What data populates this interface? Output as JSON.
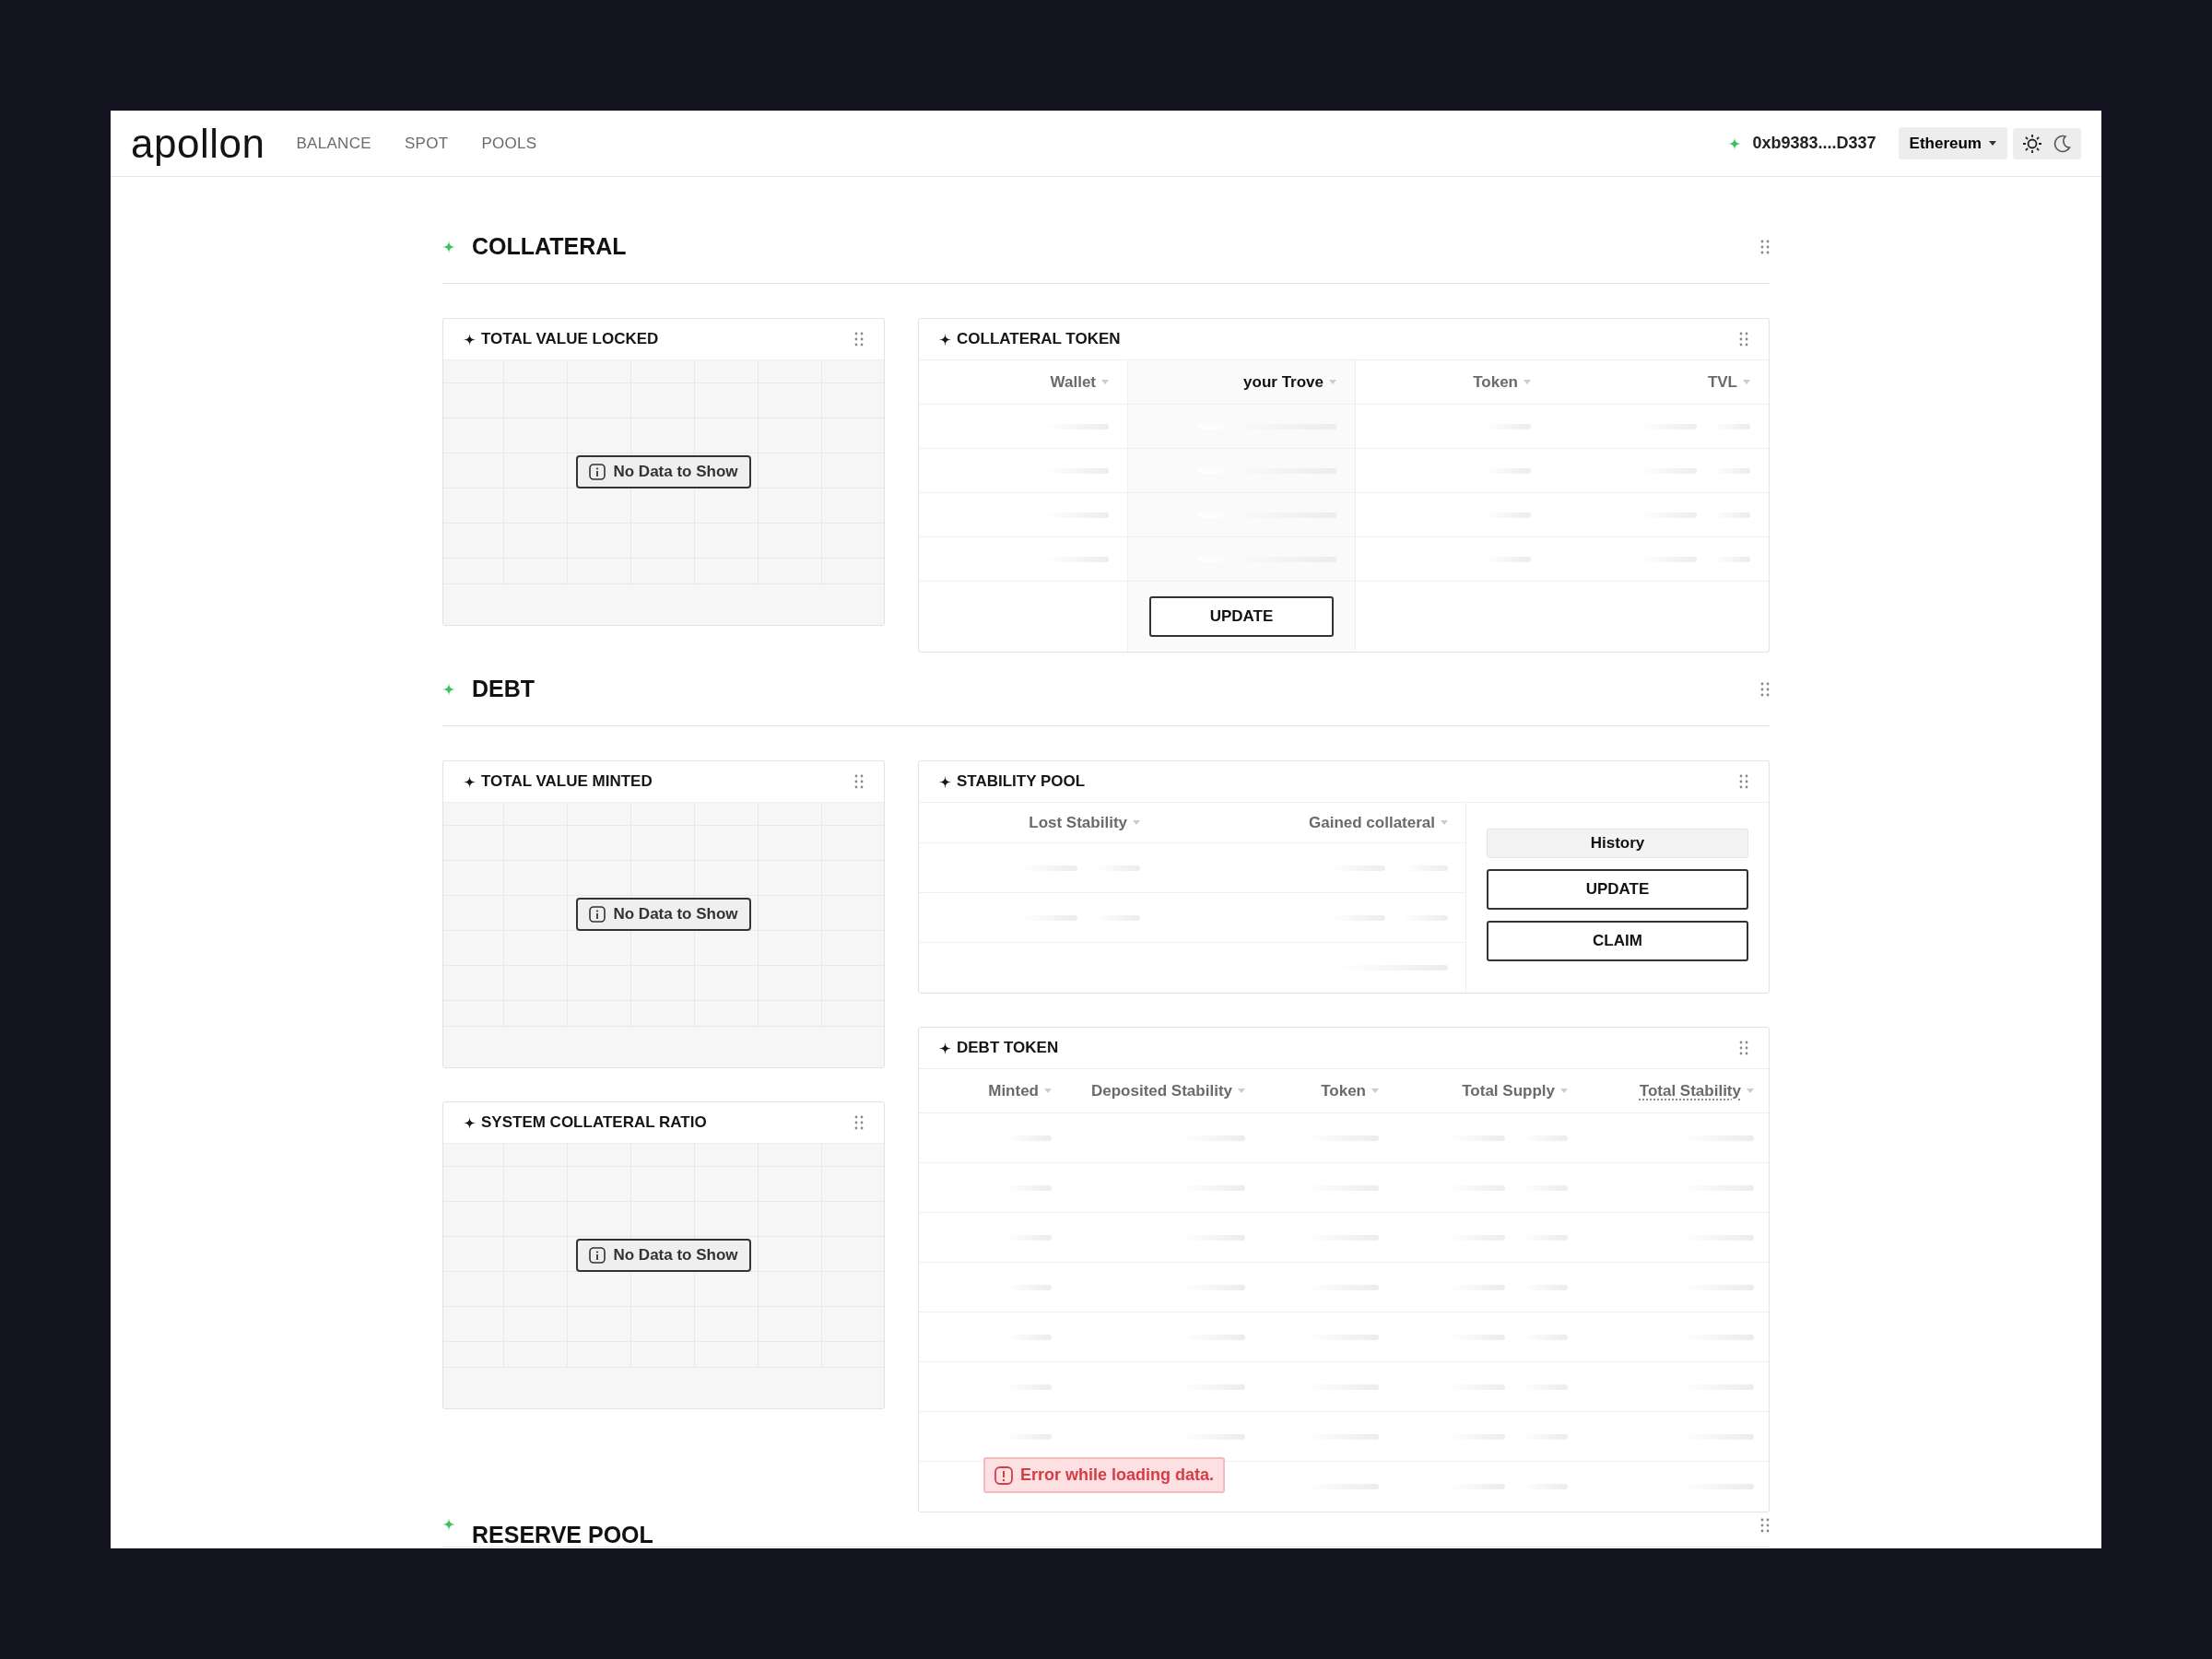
{
  "header": {
    "logo": "apollon",
    "nav": [
      {
        "label": "BALANCE"
      },
      {
        "label": "SPOT"
      },
      {
        "label": "POOLS"
      }
    ],
    "wallet_address": "0xb9383....D337",
    "network": "Ethereum"
  },
  "sections": [
    {
      "title": "COLLATERAL",
      "left": [
        {
          "kind": "chart",
          "title": "TOTAL VALUE LOCKED",
          "empty_message": "No Data to Show"
        }
      ],
      "right": [
        {
          "kind": "token_table",
          "title": "COLLATERAL TOKEN",
          "loading": true,
          "columns": [
            {
              "label": "Wallet",
              "selected": false
            },
            {
              "label": "your Trove",
              "selected": true
            },
            {
              "label": "Token",
              "selected": false
            },
            {
              "label": "TVL",
              "selected": false
            }
          ],
          "button": "UPDATE"
        }
      ]
    },
    {
      "title": "DEBT",
      "left": [
        {
          "kind": "chart",
          "title": "TOTAL VALUE MINTED",
          "empty_message": "No Data to Show"
        },
        {
          "kind": "chart",
          "title": "SYSTEM COLLATERAL RATIO",
          "empty_message": "No Data to Show"
        }
      ],
      "right": [
        {
          "kind": "pool",
          "title": "STABILITY POOL",
          "loading": true,
          "columns": [
            {
              "label": "Lost Stability"
            },
            {
              "label": "Gained collateral"
            }
          ],
          "buttons": [
            {
              "label": "History",
              "kind": "secondary"
            },
            {
              "label": "UPDATE",
              "kind": "outline"
            },
            {
              "label": "CLAIM",
              "kind": "outline"
            }
          ]
        },
        {
          "kind": "debt_table",
          "title": "DEBT TOKEN",
          "loading": true,
          "columns": [
            {
              "label": "Minted",
              "tooltip": false
            },
            {
              "label": "Deposited Stability",
              "tooltip": false
            },
            {
              "label": "Token",
              "tooltip": false
            },
            {
              "label": "Total Supply",
              "tooltip": false
            },
            {
              "label": "Total Stability",
              "tooltip": true
            }
          ],
          "error": "Error while loading data."
        }
      ]
    },
    {
      "title": "RESERVE POOL"
    }
  ]
}
